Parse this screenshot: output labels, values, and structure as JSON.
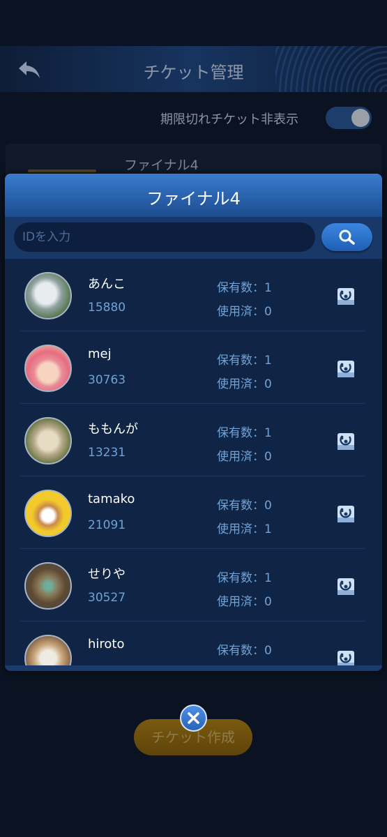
{
  "header": {
    "title": "チケット管理"
  },
  "settings": {
    "hide_expired_label": "期限切れチケット非表示",
    "hide_expired_on": true
  },
  "background_card": {
    "title": "ファイナル4"
  },
  "modal": {
    "title": "ファイナル4",
    "search": {
      "placeholder": "IDを入力",
      "value": ""
    }
  },
  "members": [
    {
      "name": "あんこ",
      "id": "15880",
      "held": "保有数：1",
      "used": "使用済：0"
    },
    {
      "name": "mej",
      "id": "30763",
      "held": "保有数：1",
      "used": "使用済：0"
    },
    {
      "name": "ももんが",
      "id": "13231",
      "held": "保有数：1",
      "used": "使用済：0"
    },
    {
      "name": "tamako",
      "id": "21091",
      "held": "保有数：0",
      "used": "使用済：1"
    },
    {
      "name": "せりや",
      "id": "30527",
      "held": "保有数：1",
      "used": "使用済：0"
    },
    {
      "name": "hiroto",
      "id": "",
      "held": "保有数：0",
      "used": ""
    }
  ],
  "footer": {
    "create_label": "チケット作成"
  },
  "colors": {
    "accent_blue": "#3a86e0",
    "gold": "#7a5a10",
    "modal_bg": "#102445"
  }
}
